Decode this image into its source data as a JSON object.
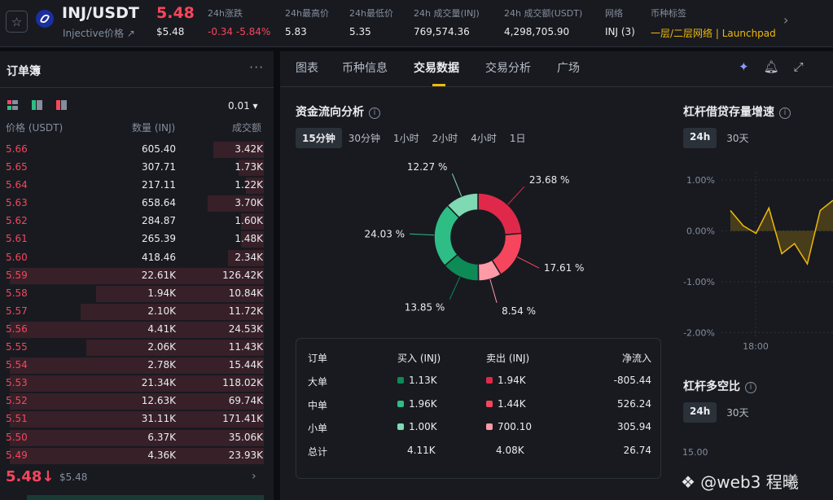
{
  "header": {
    "pair": "INJ/USDT",
    "subtitle": "Injective价格 ↗",
    "price": "5.48",
    "price_usd": "$5.48",
    "stats": [
      {
        "label": "24h涨跌",
        "value": "-0.34 -5.84%",
        "color": "red"
      },
      {
        "label": "24h最高价",
        "value": "5.83",
        "color": "normal"
      },
      {
        "label": "24h最低价",
        "value": "5.35",
        "color": "normal"
      },
      {
        "label": "24h 成交量(INJ)",
        "value": "769,574.36",
        "color": "normal"
      },
      {
        "label": "24h 成交额(USDT)",
        "value": "4,298,705.90",
        "color": "normal"
      },
      {
        "label": "网络",
        "value": "INJ (3)",
        "color": "normal"
      },
      {
        "label": "币种标签",
        "value": "一层/二层网络 | Launchpad",
        "color": "gold"
      }
    ]
  },
  "orderbook": {
    "title": "订单簿",
    "precision": "0.01 ▾",
    "columns": [
      "价格 (USDT)",
      "数量 (INJ)",
      "成交额"
    ],
    "rows": [
      {
        "price": "5.66",
        "qty": "605.40",
        "total": "3.42K",
        "depth": 0.2
      },
      {
        "price": "5.65",
        "qty": "307.71",
        "total": "1.73K",
        "depth": 0.1
      },
      {
        "price": "5.64",
        "qty": "217.11",
        "total": "1.22K",
        "depth": 0.07
      },
      {
        "price": "5.63",
        "qty": "658.64",
        "total": "3.70K",
        "depth": 0.22
      },
      {
        "price": "5.62",
        "qty": "284.87",
        "total": "1.60K",
        "depth": 0.09
      },
      {
        "price": "5.61",
        "qty": "265.39",
        "total": "1.48K",
        "depth": 0.09
      },
      {
        "price": "5.60",
        "qty": "418.46",
        "total": "2.34K",
        "depth": 0.14
      },
      {
        "price": "5.59",
        "qty": "22.61K",
        "total": "126.42K",
        "depth": 1.0
      },
      {
        "price": "5.58",
        "qty": "1.94K",
        "total": "10.84K",
        "depth": 0.66
      },
      {
        "price": "5.57",
        "qty": "2.10K",
        "total": "11.72K",
        "depth": 0.72
      },
      {
        "price": "5.56",
        "qty": "4.41K",
        "total": "24.53K",
        "depth": 1.0
      },
      {
        "price": "5.55",
        "qty": "2.06K",
        "total": "11.43K",
        "depth": 0.7
      },
      {
        "price": "5.54",
        "qty": "2.78K",
        "total": "15.44K",
        "depth": 1.0
      },
      {
        "price": "5.53",
        "qty": "21.34K",
        "total": "118.02K",
        "depth": 1.0
      },
      {
        "price": "5.52",
        "qty": "12.63K",
        "total": "69.74K",
        "depth": 1.0
      },
      {
        "price": "5.51",
        "qty": "31.11K",
        "total": "171.41K",
        "depth": 1.0
      },
      {
        "price": "5.50",
        "qty": "6.37K",
        "total": "35.06K",
        "depth": 1.0
      },
      {
        "price": "5.49",
        "qty": "4.36K",
        "total": "23.93K",
        "depth": 1.0
      }
    ],
    "last_price": "5.48↓",
    "last_price_usd": "$5.48"
  },
  "tabs": [
    "图表",
    "币种信息",
    "交易数据",
    "交易分析",
    "广场"
  ],
  "active_tab": "交易数据",
  "flow": {
    "title": "资金流向分析",
    "timeframes": [
      "15分钟",
      "30分钟",
      "1小时",
      "2小时",
      "4小时",
      "1日"
    ],
    "active_timeframe": "15分钟",
    "slices": [
      {
        "label": "23.68 %",
        "value": 23.68,
        "color": "#e0294a"
      },
      {
        "label": "17.61 %",
        "value": 17.61,
        "color": "#f6465d"
      },
      {
        "label": "8.54 %",
        "value": 8.54,
        "color": "#ff9aa6"
      },
      {
        "label": "13.85 %",
        "value": 13.85,
        "color": "#0e8a57"
      },
      {
        "label": "24.03 %",
        "value": 24.03,
        "color": "#2ebd85"
      },
      {
        "label": "12.27 %",
        "value": 12.27,
        "color": "#7fd9b2"
      }
    ],
    "table": {
      "headers": [
        "订单",
        "买入 (INJ)",
        "卖出 (INJ)",
        "净流入"
      ],
      "rows": [
        {
          "name": "大单",
          "buy": "1.13K",
          "sell": "1.94K",
          "net": "-805.44",
          "buy_color": "#0e8a57",
          "sell_color": "#e0294a"
        },
        {
          "name": "中单",
          "buy": "1.96K",
          "sell": "1.44K",
          "net": "526.24",
          "buy_color": "#2ebd85",
          "sell_color": "#f6465d"
        },
        {
          "name": "小单",
          "buy": "1.00K",
          "sell": "700.10",
          "net": "305.94",
          "buy_color": "#7fd9b2",
          "sell_color": "#ff9aa6"
        },
        {
          "name": "总计",
          "buy": "4.11K",
          "sell": "4.08K",
          "net": "26.74",
          "buy_color": "",
          "sell_color": ""
        }
      ]
    }
  },
  "margin": {
    "title": "杠杆借贷存量增速",
    "timeframes": [
      "24h",
      "30天"
    ],
    "active": "24h",
    "chart_data": {
      "type": "line",
      "y_ticks": [
        "1.00%",
        "0.00%",
        "-1.00%",
        "-2.00%"
      ],
      "ylim": [
        -2.0,
        1.0
      ],
      "x_tick": "18:00",
      "values": [
        0.4,
        0.1,
        -0.05,
        0.45,
        -0.45,
        -0.25,
        -0.65,
        0.4,
        0.6
      ]
    }
  },
  "longshort": {
    "title": "杠杆多空比",
    "timeframes": [
      "24h",
      "30天"
    ],
    "active": "24h",
    "y_tick": "15.00"
  },
  "watermark": "❖ @web3  程曦"
}
